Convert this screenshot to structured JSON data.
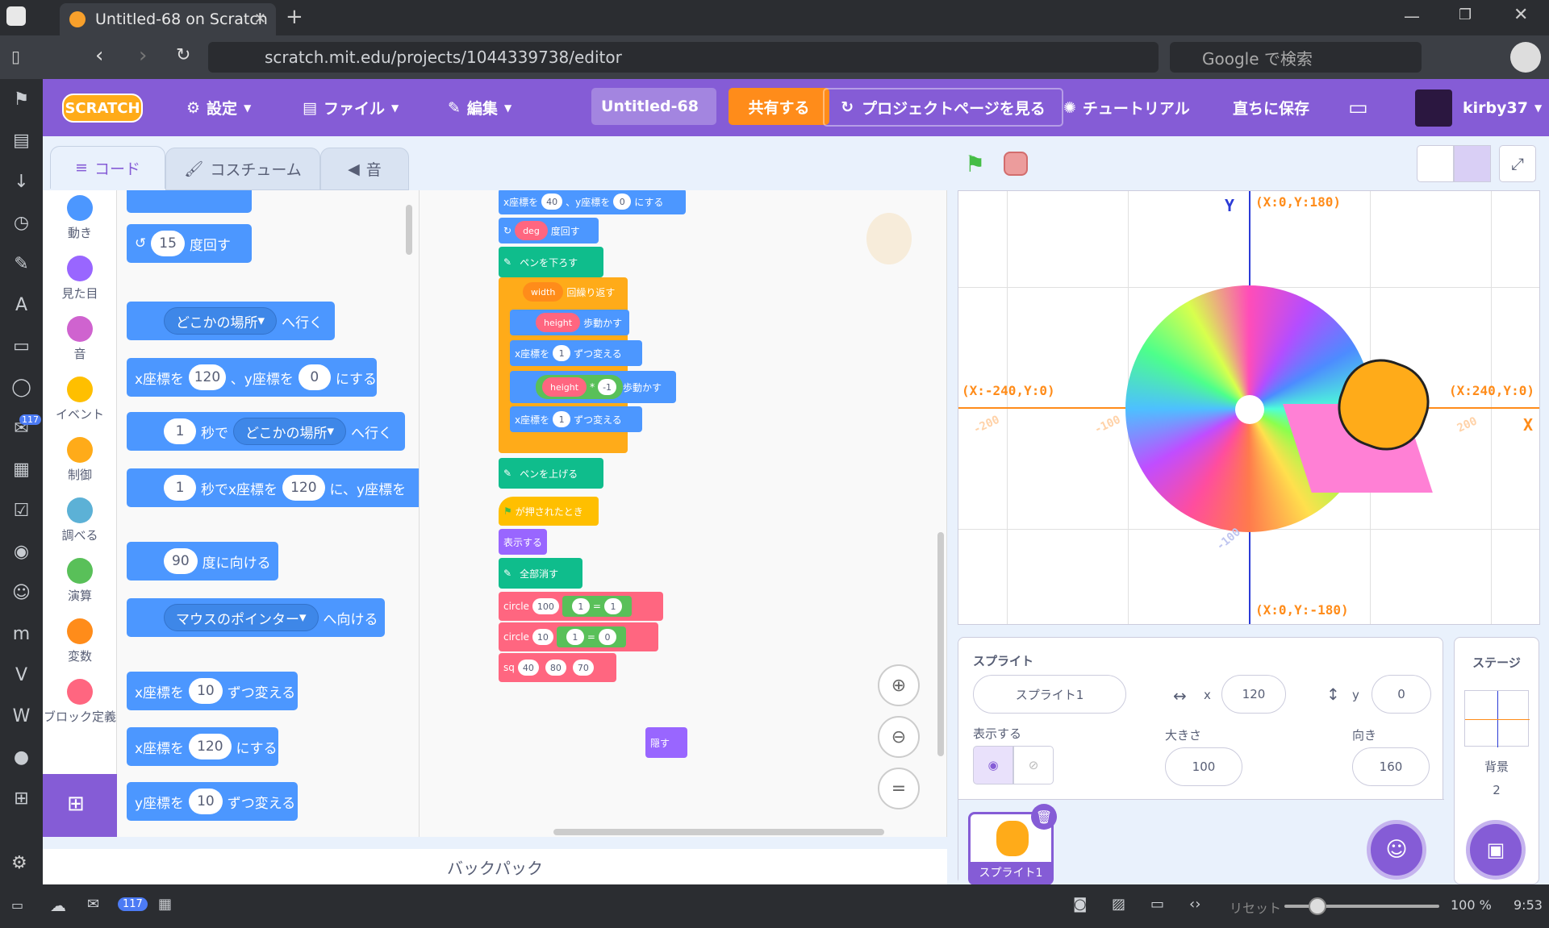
{
  "browser": {
    "tab_title": "Untitled-68 on Scratch",
    "url": "scratch.mit.edu/projects/1044339738/editor",
    "search_placeholder": "Google で検索",
    "tab_count_badge": "117"
  },
  "menu": {
    "settings": "設定",
    "file": "ファイル",
    "edit": "編集",
    "project_title": "Untitled-68",
    "share": "共有する",
    "project_page": "プロジェクトページを見る",
    "tutorial": "チュートリアル",
    "save_now": "直ちに保存",
    "username": "kirby37"
  },
  "editor_tabs": {
    "code": "コード",
    "costume": "コスチューム",
    "sound": "音"
  },
  "categories": [
    "動き",
    "見た目",
    "音",
    "イベント",
    "制御",
    "調べる",
    "演算",
    "変数",
    "ブロック定義"
  ],
  "palette": {
    "turn_ccw_label": "度回す",
    "turn_deg": "15",
    "goto_label": "どこかの場所",
    "goto_suffix": "へ行く",
    "setxy_x_label": "x座標を",
    "setxy_x": "120",
    "setxy_y_label": "、y座標を",
    "setxy_y": "0",
    "setxy_suffix": "にする",
    "glide_secs": "1",
    "glide_label": "秒で",
    "glide_target": "どこかの場所",
    "glide_suffix": "へ行く",
    "glidexy_secs": "1",
    "glidexy_label": "秒でx座標を",
    "glidexy_x": "120",
    "glidexy_mid": "に、y座標を",
    "point_deg": "90",
    "point_label": "度に向ける",
    "point_towards": "マウスのポインター",
    "point_towards_suffix": "へ向ける",
    "changex_label": "x座標を",
    "changex_val": "10",
    "changex_suffix": "ずつ変える",
    "setx_label": "x座標を",
    "setx_val": "120",
    "setx_suffix": "にする",
    "changey_label": "y座標を",
    "changey_val": "10",
    "changey_suffix": "ずつ変える"
  },
  "script": {
    "setxy_label": "x座標を",
    "setxy_x": "40",
    "setxy_mid": "、y座標を",
    "setxy_y": "0",
    "setxy_suffix": "にする",
    "turn_var": "deg",
    "turn_suffix": "度回す",
    "pen_down": "ペンを下ろす",
    "repeat_var": "width",
    "repeat_suffix": "回繰り返す",
    "move_var": "height",
    "move_suffix": "歩動かす",
    "changex1_label": "x座標を",
    "changex1_val": "1",
    "changex1_suffix": "ずつ変える",
    "move2_var": "height",
    "move2_op": "*",
    "move2_val": "-1",
    "move2_suffix": "歩動かす",
    "changex2_label": "x座標を",
    "changex2_val": "1",
    "changex2_suffix": "ずつ変える",
    "pen_up": "ペンを上げる",
    "flag_label": "が押されたとき",
    "show": "表示する",
    "clear": "全部消す",
    "circle1_name": "circle",
    "circle1_r": "100",
    "circle1_a": "1",
    "circle1_op": "=",
    "circle1_b": "1",
    "circle2_name": "circle",
    "circle2_r": "10",
    "circle2_a": "1",
    "circle2_op": "=",
    "circle2_b": "0",
    "sq_name": "sq",
    "sq_a": "40",
    "sq_b": "80",
    "sq_c": "70",
    "hide": "隠す"
  },
  "backpack": "バックパック",
  "stage_labels": {
    "y_axis": "Y",
    "x_axis": "X",
    "top": "(X:0,Y:180)",
    "bottom": "(X:0,Y:-180)",
    "left": "(X:-240,Y:0)",
    "right": "(X:240,Y:0)",
    "tick_neg200": "-200",
    "tick_neg100": "-100",
    "tick_200": "200",
    "tick_y_neg100": "-100"
  },
  "sprite_panel": {
    "label": "スプライト",
    "name": "スプライト1",
    "x_label": "x",
    "x": "120",
    "y_label": "y",
    "y": "0",
    "show_label": "表示する",
    "size_label": "大きさ",
    "size": "100",
    "direction_label": "向き",
    "direction": "160",
    "thumb_name": "スプライト1"
  },
  "stage_panel": {
    "label": "ステージ",
    "backdrop_label": "背景",
    "backdrop_count": "2"
  },
  "status": {
    "badge": "117",
    "reset": "リセット",
    "zoom": "100 %",
    "time": "9:53"
  }
}
